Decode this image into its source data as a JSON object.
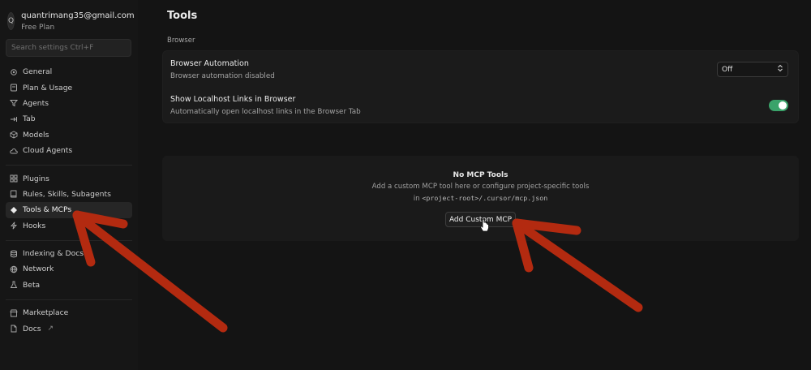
{
  "account": {
    "avatar_letter": "Q",
    "email": "quantrimang35@gmail.com",
    "plan": "Free Plan"
  },
  "search": {
    "placeholder": "Search settings Ctrl+F"
  },
  "sidebar": {
    "groups": [
      [
        {
          "label": "General",
          "icon": "gear-icon"
        },
        {
          "label": "Plan & Usage",
          "icon": "document-icon"
        },
        {
          "label": "Agents",
          "icon": "funnel-icon"
        },
        {
          "label": "Tab",
          "icon": "tab-arrow-icon"
        },
        {
          "label": "Models",
          "icon": "cube-icon"
        },
        {
          "label": "Cloud Agents",
          "icon": "cloud-icon"
        }
      ],
      [
        {
          "label": "Plugins",
          "icon": "grid-icon"
        },
        {
          "label": "Rules, Skills, Subagents",
          "icon": "book-icon"
        },
        {
          "label": "Tools & MCPs",
          "icon": "diamond-icon",
          "active": true
        },
        {
          "label": "Hooks",
          "icon": "bolt-icon"
        }
      ],
      [
        {
          "label": "Indexing & Docs",
          "icon": "database-icon"
        },
        {
          "label": "Network",
          "icon": "globe-icon"
        },
        {
          "label": "Beta",
          "icon": "flask-icon"
        }
      ],
      [
        {
          "label": "Marketplace",
          "icon": "store-icon"
        },
        {
          "label": "Docs",
          "icon": "doc-icon",
          "external": "↗"
        }
      ]
    ]
  },
  "main": {
    "title": "Tools",
    "section_label": "Browser",
    "browser_automation": {
      "title": "Browser Automation",
      "desc": "Browser automation disabled",
      "value": "Off"
    },
    "localhost_links": {
      "title": "Show Localhost Links in Browser",
      "desc": "Automatically open localhost links in the Browser Tab",
      "enabled": true
    },
    "mcp": {
      "title": "No MCP Tools",
      "line1": "Add a custom MCP tool here or configure project-specific tools",
      "line2_prefix": "in ",
      "line2_code": "<project-root>/.cursor/mcp.json",
      "button": "Add Custom MCP"
    }
  },
  "colors": {
    "arrow": "#b32a10",
    "toggle_on": "#3aa36a"
  }
}
